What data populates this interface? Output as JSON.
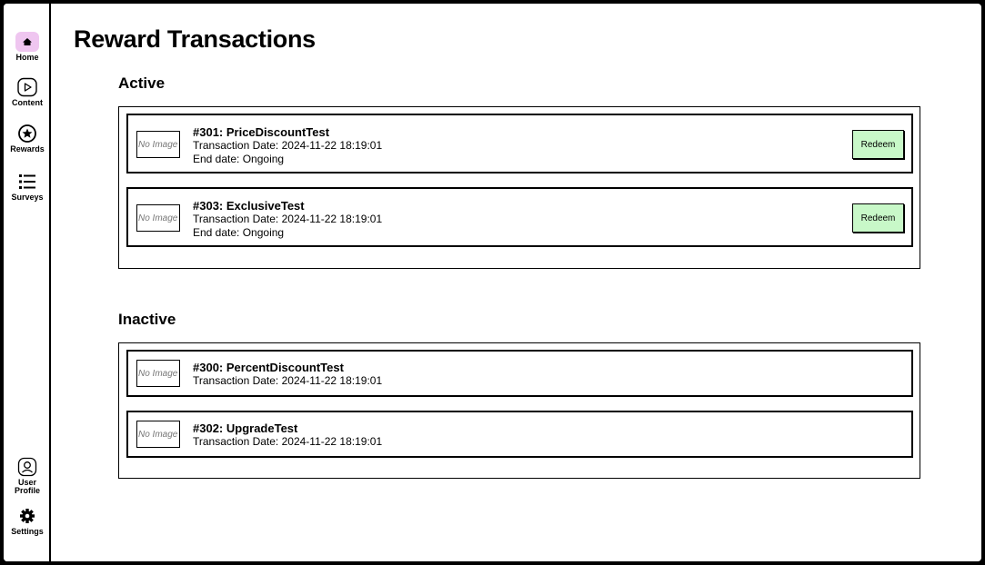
{
  "nav": {
    "home": "Home",
    "content": "Content",
    "rewards": "Rewards",
    "surveys": "Surveys",
    "user_profile": "User Profile",
    "settings": "Settings",
    "active_color": "#efc6f0"
  },
  "page": {
    "title": "Reward Transactions"
  },
  "sections": {
    "active": {
      "title": "Active",
      "items": [
        {
          "thumb": "No Image",
          "title": "#301: PriceDiscountTest",
          "date": "Transaction Date: 2024-11-22 18:19:01",
          "end": "End date: Ongoing",
          "action": "Redeem"
        },
        {
          "thumb": "No Image",
          "title": "#303: ExclusiveTest",
          "date": "Transaction Date: 2024-11-22 18:19:01",
          "end": "End date: Ongoing",
          "action": "Redeem"
        }
      ]
    },
    "inactive": {
      "title": "Inactive",
      "items": [
        {
          "thumb": "No Image",
          "title": "#300: PercentDiscountTest",
          "date": "Transaction Date: 2024-11-22 18:19:01"
        },
        {
          "thumb": "No Image",
          "title": "#302: UpgradeTest",
          "date": "Transaction Date: 2024-11-22 18:19:01"
        }
      ]
    }
  },
  "colors": {
    "redeem_bg": "#c8f8c8"
  }
}
